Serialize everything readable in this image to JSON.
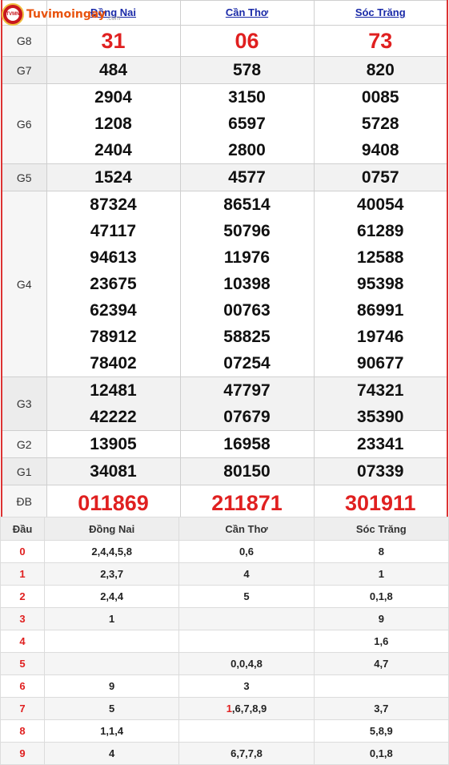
{
  "logo": {
    "text": "Tuvimoingay",
    "sub": ".com",
    "badge": "TVMN"
  },
  "provinces": [
    "Đồng Nai",
    "Cần Thơ",
    "Sóc Trăng"
  ],
  "prizes": [
    {
      "label": "G8",
      "values": [
        [
          "31"
        ],
        [
          "06"
        ],
        [
          "73"
        ]
      ]
    },
    {
      "label": "G7",
      "values": [
        [
          "484"
        ],
        [
          "578"
        ],
        [
          "820"
        ]
      ]
    },
    {
      "label": "G6",
      "values": [
        [
          "2904",
          "1208",
          "2404"
        ],
        [
          "3150",
          "6597",
          "2800"
        ],
        [
          "0085",
          "5728",
          "9408"
        ]
      ]
    },
    {
      "label": "G5",
      "values": [
        [
          "1524"
        ],
        [
          "4577"
        ],
        [
          "0757"
        ]
      ]
    },
    {
      "label": "G4",
      "values": [
        [
          "87324",
          "47117",
          "94613",
          "23675",
          "62394",
          "78912",
          "78402"
        ],
        [
          "86514",
          "50796",
          "11976",
          "10398",
          "00763",
          "58825",
          "07254"
        ],
        [
          "40054",
          "61289",
          "12588",
          "95398",
          "86991",
          "19746",
          "90677"
        ]
      ]
    },
    {
      "label": "G3",
      "values": [
        [
          "12481",
          "42222"
        ],
        [
          "47797",
          "07679"
        ],
        [
          "74321",
          "35390"
        ]
      ]
    },
    {
      "label": "G2",
      "values": [
        [
          "13905"
        ],
        [
          "16958"
        ],
        [
          "23341"
        ]
      ]
    },
    {
      "label": "G1",
      "values": [
        [
          "34081"
        ],
        [
          "80150"
        ],
        [
          "07339"
        ]
      ]
    },
    {
      "label": "ĐB",
      "values": [
        [
          "011869"
        ],
        [
          "211871"
        ],
        [
          "301911"
        ]
      ]
    }
  ],
  "loto": {
    "header": {
      "dau": "Đầu",
      "cols": [
        "Đồng Nai",
        "Cần Thơ",
        "Sóc Trăng"
      ]
    },
    "rows": [
      {
        "dau": "0",
        "cells": [
          "2,4,4,5,8",
          "0,6",
          "8"
        ]
      },
      {
        "dau": "1",
        "cells": [
          "2,3,7",
          "4",
          "1"
        ]
      },
      {
        "dau": "2",
        "cells": [
          "2,4,4",
          "5",
          "0,1,8"
        ]
      },
      {
        "dau": "3",
        "cells": [
          "1",
          "",
          "9"
        ]
      },
      {
        "dau": "4",
        "cells": [
          "",
          "",
          "1,6"
        ]
      },
      {
        "dau": "5",
        "cells": [
          "",
          "0,0,4,8",
          "4,7"
        ]
      },
      {
        "dau": "6",
        "cells": [
          "9",
          "3",
          ""
        ]
      },
      {
        "dau": "7",
        "cells": [
          "5",
          "1,6,7,8,9",
          "3,7"
        ]
      },
      {
        "dau": "8",
        "cells": [
          "1,1,4",
          "",
          "5,8,9"
        ]
      },
      {
        "dau": "9",
        "cells": [
          "4",
          "6,7,7,8",
          "0,1,8"
        ]
      }
    ],
    "highlights": [
      "1-2-full",
      "6-0-full",
      "7-1-first"
    ]
  },
  "colors": {
    "accent": "#e02020",
    "link": "#1a2aa8",
    "logo": "#e8530e"
  }
}
